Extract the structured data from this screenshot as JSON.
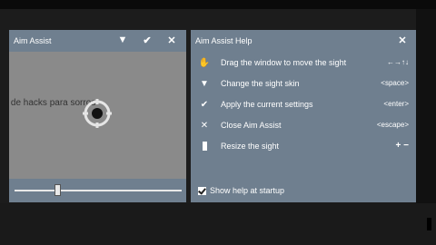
{
  "aim_window": {
    "title": "Aim Assist",
    "background_text": "ón de hacks para sorros",
    "icons": {
      "dropdown": "triangle-down-icon",
      "apply": "check-icon",
      "close": "close-icon"
    },
    "slider_level": 0.25
  },
  "help_window": {
    "title": "Aim Assist Help",
    "rows": [
      {
        "icon": "hand-icon",
        "label": "Drag the window to move the sight",
        "key": "←→↑↓"
      },
      {
        "icon": "triangle-down-icon",
        "label": "Change the sight skin",
        "key": "<space>"
      },
      {
        "icon": "check-icon",
        "label": "Apply the current settings",
        "key": "<enter>"
      },
      {
        "icon": "close-icon",
        "label": "Close Aim Assist",
        "key": "<escape>"
      },
      {
        "icon": "rectangle-icon",
        "label": "Resize the sight",
        "key": "+ −"
      }
    ],
    "show_help_label": "Show help at startup",
    "show_help_checked": true
  },
  "colors": {
    "window_bg": "#6f7f8f",
    "canvas_bg": "#8a8a8a",
    "desktop": "#1c1c1c"
  }
}
